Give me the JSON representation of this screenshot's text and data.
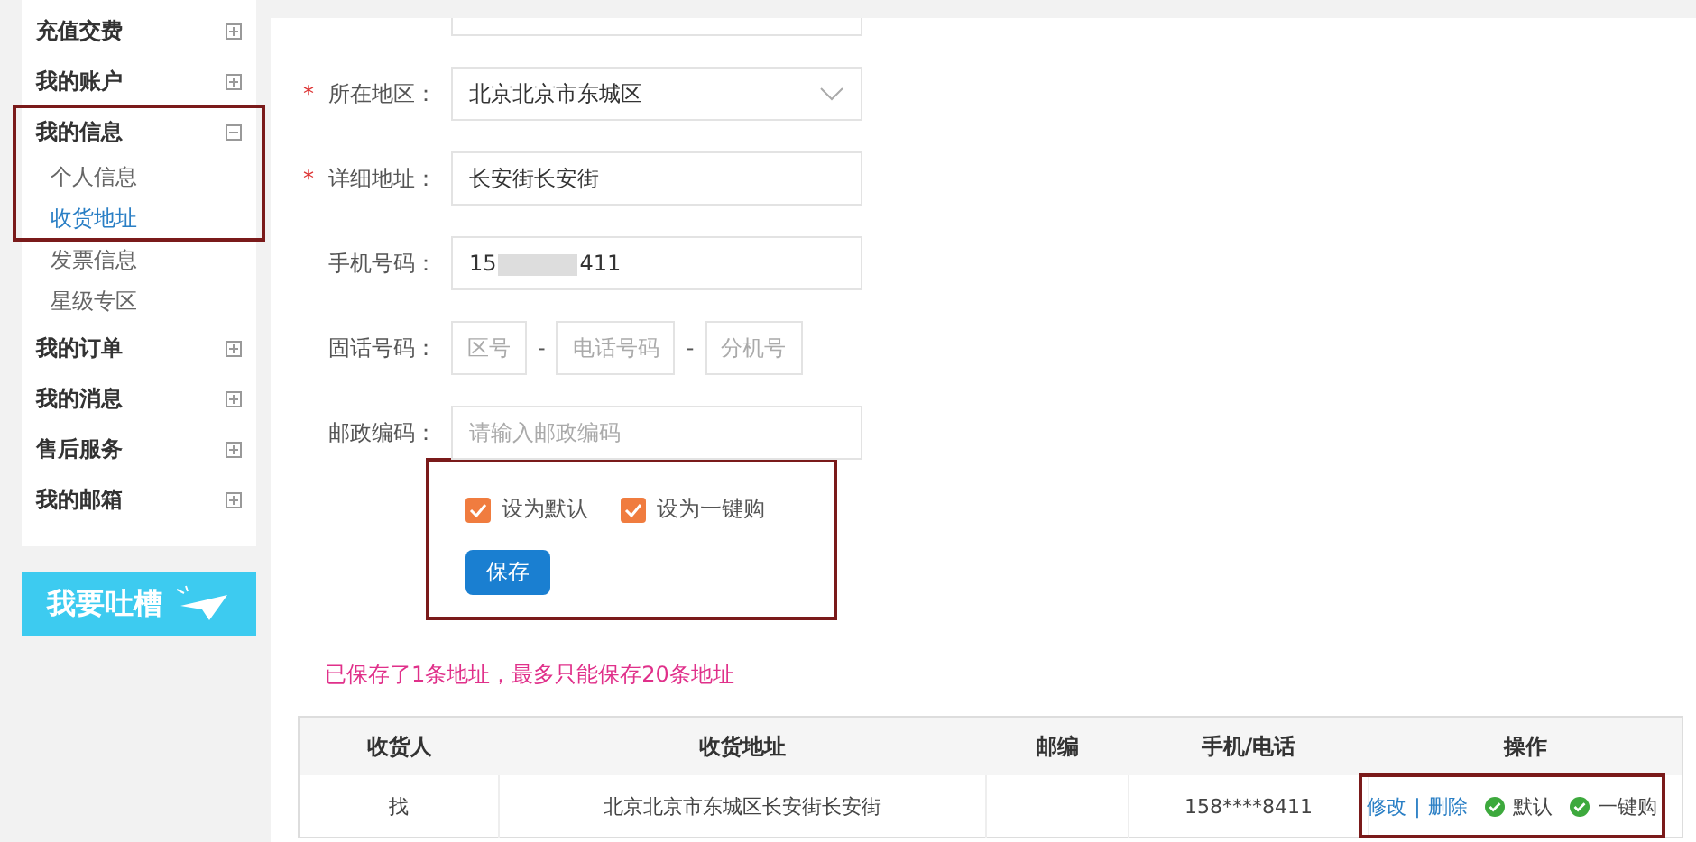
{
  "sidebar": {
    "items": [
      {
        "label": "充值交费",
        "expanded": false,
        "highlighted": false
      },
      {
        "label": "我的账户",
        "expanded": false,
        "highlighted": false
      },
      {
        "label": "我的信息",
        "expanded": true,
        "highlighted": true,
        "children": [
          {
            "label": "个人信息",
            "selected": false
          },
          {
            "label": "收货地址",
            "selected": true
          },
          {
            "label": "发票信息",
            "selected": false
          },
          {
            "label": "星级专区",
            "selected": false
          }
        ]
      },
      {
        "label": "我的订单",
        "expanded": false,
        "highlighted": false
      },
      {
        "label": "我的消息",
        "expanded": false,
        "highlighted": false
      },
      {
        "label": "售后服务",
        "expanded": false,
        "highlighted": false
      },
      {
        "label": "我的邮箱",
        "expanded": false,
        "highlighted": false
      }
    ],
    "banner": {
      "label": "我要吐槽"
    }
  },
  "form": {
    "required_mark": "*",
    "rows": [
      {
        "kind": "stub"
      },
      {
        "kind": "select",
        "label": "所在地区：",
        "required": true,
        "value": "北京北京市东城区"
      },
      {
        "kind": "text",
        "label": "详细地址：",
        "required": true,
        "value": "长安街长安街"
      },
      {
        "kind": "masked",
        "label": "手机号码：",
        "required": false,
        "prefix": "15",
        "suffix": "411"
      },
      {
        "kind": "phone",
        "label": "固话号码：",
        "required": false,
        "parts": [
          {
            "placeholder": "区号"
          },
          {
            "separator": "-",
            "placeholder": "电话号码"
          },
          {
            "separator": "-",
            "placeholder": "分机号"
          }
        ]
      },
      {
        "kind": "text",
        "label": "邮政编码：",
        "required": false,
        "placeholder": "请输入邮政编码"
      }
    ],
    "options": [
      {
        "label": "设为默认",
        "checked": true
      },
      {
        "label": "设为一键购",
        "checked": true
      }
    ],
    "save_button": "保存"
  },
  "notice": "已保存了1条地址，最多只能保存20条地址",
  "table": {
    "columns": [
      "收货人",
      "收货地址",
      "邮编",
      "手机/电话",
      "操作"
    ],
    "action_separator": "|",
    "rows": [
      {
        "name": "找",
        "address": "北京北京市东城区长安街长安街",
        "phone": "158****8411",
        "actions": [
          {
            "label": "修改"
          },
          {
            "label": "删除"
          }
        ],
        "flags": [
          {
            "label": "默认",
            "on": true
          },
          {
            "label": "一键购",
            "on": true
          }
        ]
      }
    ]
  }
}
